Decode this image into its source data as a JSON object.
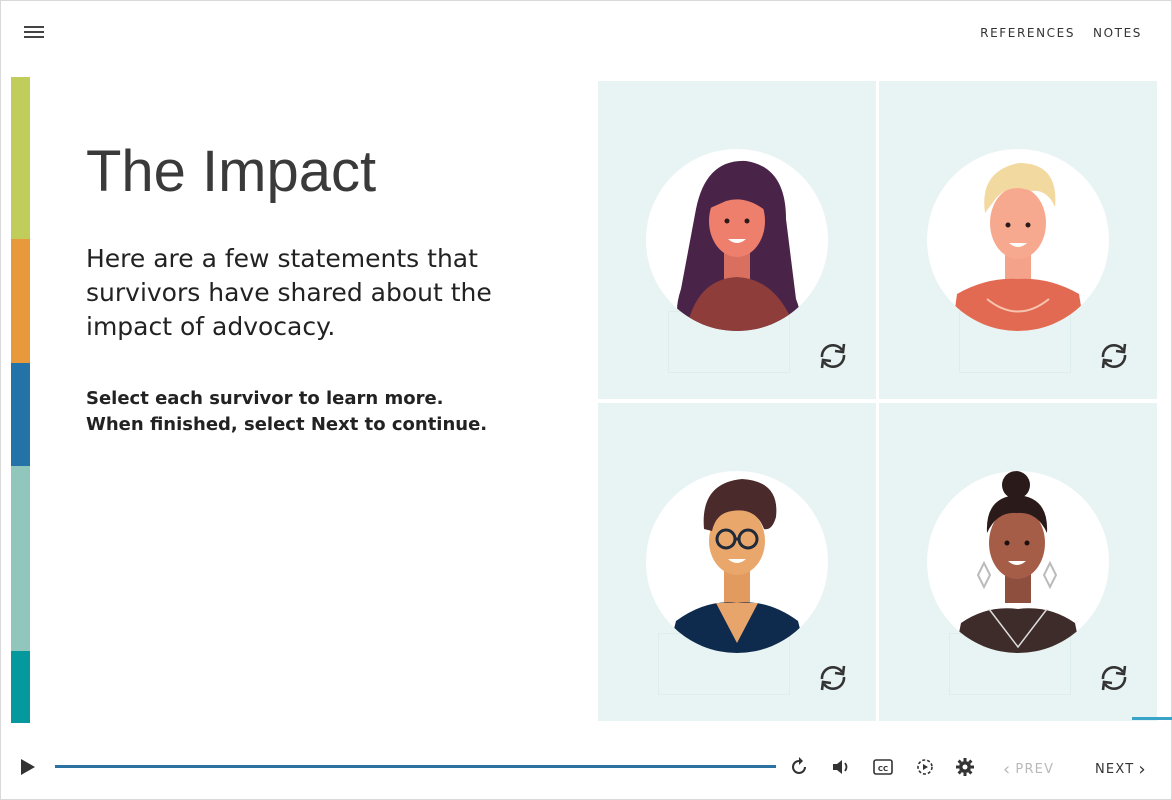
{
  "header": {
    "references_label": "REFERENCES",
    "notes_label": "NOTES"
  },
  "stripe_colors": [
    "#c1cd5b",
    "#e8993b",
    "#2473a8",
    "#90c6bb",
    "#05999e"
  ],
  "slide": {
    "title": "The Impact",
    "intro": "Here are a few statements that survivors have shared about the impact of advocacy.",
    "instructions": [
      "Select each survivor to learn more.",
      "When finished, select Next to continue."
    ]
  },
  "cards": [
    {
      "name": "survivor-1",
      "icon": "flip-icon"
    },
    {
      "name": "survivor-2",
      "icon": "flip-icon"
    },
    {
      "name": "survivor-3",
      "icon": "flip-icon"
    },
    {
      "name": "survivor-4",
      "icon": "flip-icon"
    }
  ],
  "player": {
    "progress": 1.0,
    "prev_label": "PREV",
    "next_label": "NEXT"
  },
  "colors": {
    "seek_bar": "#2b72a0",
    "card_bg": "#e8f4f3"
  }
}
